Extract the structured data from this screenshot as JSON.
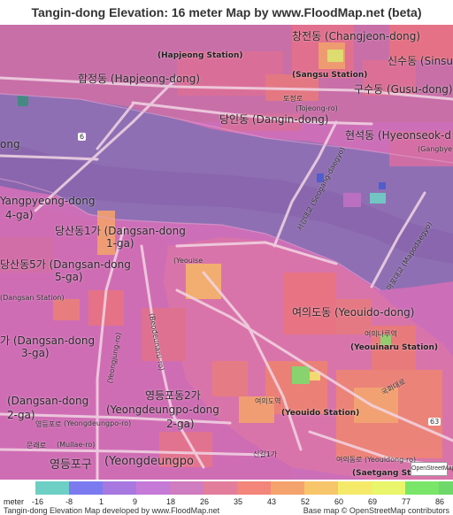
{
  "title": "Tangin-dong Elevation: 16 meter Map by www.FloodMap.net (beta)",
  "map_labels": {
    "changjeon": "창전동 (Changjeon-dong)",
    "hapjeong_station": "(Hapjeong Station)",
    "sinsu": "신수동 (Sinsu",
    "sangsu_station": "(Sangsu Station)",
    "hapjeong_dong": "합정동 (Hapjeong-dong)",
    "gusu": "구수동 (Gusu-dong)",
    "tojeong_ro_ko": "토정로",
    "tojeong_ro": "(Tojeong-ro)",
    "dangin": "당인동 (Dangin-dong)",
    "hyeonseok": "현석동 (Hyeonseok-d",
    "ong": "ong",
    "gangbyeon": "(Gangbye",
    "route6": "6",
    "yangpyeong": "Yangpyeong-dong",
    "yangpyeong_ga": "4-ga)",
    "dangsan1_ko": "당산동1가 (Dangsan-dong",
    "dangsan1_ga": "1-ga)",
    "dangsan5": "당산동5가 (Dangsan-dong",
    "dangsan5_ga": "5-ga)",
    "dangsan3": "가 (Dangsan-dong",
    "dangsan3_ga": "3-ga)",
    "dangsan2": "(Dangsan-dong",
    "dangsan2_ga": "2-ga)",
    "yeouido": "여의도동 (Yeouido-dong)",
    "yeouinaru_ko": "여의나루역",
    "yeouinaru": "(Yeouinaru Station)",
    "yeouido_station_ko": "여의도역",
    "yeouido_station": "(Yeouido Station)",
    "yeongdeungpo2_ko": "영등포동2가",
    "yeongdeungpo2": "(Yeongdeungpo-dong",
    "yeongdeungpo2_ga": "2-ga)",
    "yeongdeungpo_gu_ko": "영등포구",
    "yeongdeungpo_gu": "(Yeongdeungpo",
    "yeongdeungpo_ro_ko": "영등포로",
    "yeongdeungpo_ro": "(Yeongdeungpo-ro)",
    "mullae_ro_ko": "문래로",
    "mullae_ro": "(Mullae-ro)",
    "yeouido_ro": "여의동로 (Yeouidong-ro)",
    "saetgang": "(Saetgang Station",
    "singil": "신길1가",
    "gukhoe": "국회대로",
    "gukhoe_rd": "(Gukhoe-daero)",
    "yeouiseo": "(Yeouise",
    "mapodae": "마포대교 (Mapodaegyo)",
    "seogang": "서강대교 (Seogang-daegyo)",
    "yeongjung": "(Yeongjung-ro)",
    "beodeunaru": "(Beodeunaru-ro)",
    "route63": "63",
    "dangsan_sta": "(Dangsan Station)"
  },
  "legend": {
    "meter_label": "meter",
    "ticks": [
      "-16",
      "-8",
      "1",
      "9",
      "18",
      "26",
      "35",
      "43",
      "52",
      "60",
      "69",
      "77",
      "86"
    ],
    "colors": [
      "#6ecfc5",
      "#7b7bef",
      "#a678e0",
      "#c57ad8",
      "#d07cc0",
      "#e37d9c",
      "#f3857a",
      "#f5a36e",
      "#f7c56a",
      "#f5e96a",
      "#e9f56a",
      "#79e66a",
      "#6fd86a"
    ]
  },
  "footer": {
    "left": "Tangin-dong Elevation Map developed by www.FloodMap.net",
    "right": "Base map © OpenStreetMap contributors"
  },
  "attribution_logo": "OpenStreetMap"
}
